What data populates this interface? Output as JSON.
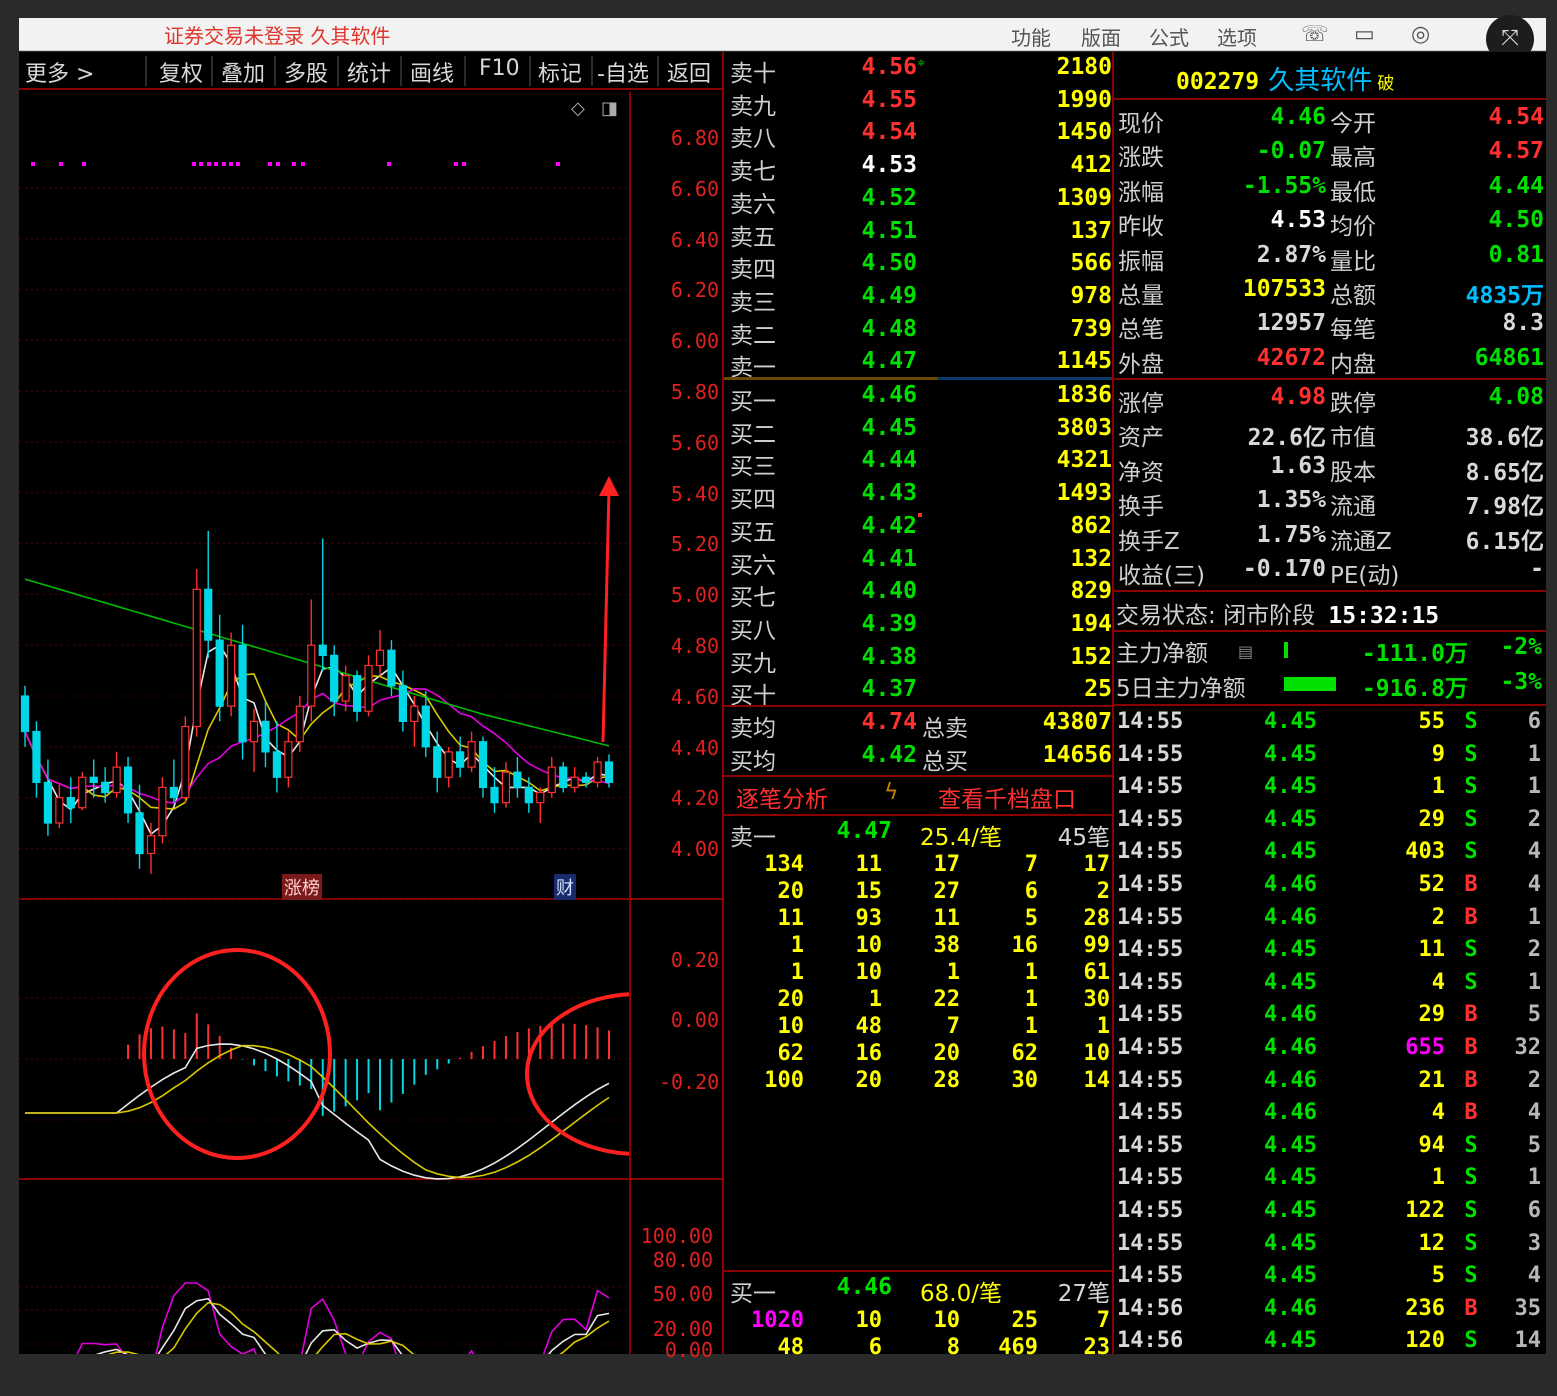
{
  "titlebar": {
    "title": "证券交易未登录 久其软件",
    "menus": [
      "功能",
      "版面",
      "公式",
      "选项"
    ]
  },
  "toolbar": {
    "items": [
      "更多 >",
      "复权",
      "叠加",
      "多股",
      "统计",
      "画线",
      "F10",
      "标记",
      "-自选",
      "返回"
    ]
  },
  "chart": {
    "price_labels": [
      "6.80",
      "6.60",
      "6.40",
      "6.20",
      "6.00",
      "5.80",
      "5.60",
      "5.40",
      "5.20",
      "5.00",
      "4.80",
      "4.60",
      "4.40",
      "4.20",
      "4.00"
    ],
    "macd_labels": [
      "0.20",
      "0.00",
      "-0.20"
    ],
    "kdj_labels": [
      "100.00",
      "80.00",
      "50.00",
      "20.00",
      "0.00"
    ],
    "badge_zhangbang": "涨榜",
    "badge_cai": "财"
  },
  "orderbook": {
    "asks": [
      {
        "label": "卖十",
        "price": "4.56",
        "vol": "2180",
        "color": "#ff3030"
      },
      {
        "label": "卖九",
        "price": "4.55",
        "vol": "1990",
        "color": "#ff3030"
      },
      {
        "label": "卖八",
        "price": "4.54",
        "vol": "1450",
        "color": "#ff3030"
      },
      {
        "label": "卖七",
        "price": "4.53",
        "vol": "412",
        "color": "#ffffff"
      },
      {
        "label": "卖六",
        "price": "4.52",
        "vol": "1309",
        "color": "#00e000"
      },
      {
        "label": "卖五",
        "price": "4.51",
        "vol": "137",
        "color": "#00e000"
      },
      {
        "label": "卖四",
        "price": "4.50",
        "vol": "566",
        "color": "#00e000"
      },
      {
        "label": "卖三",
        "price": "4.49",
        "vol": "978",
        "color": "#00e000"
      },
      {
        "label": "卖二",
        "price": "4.48",
        "vol": "739",
        "color": "#00e000"
      },
      {
        "label": "卖一",
        "price": "4.47",
        "vol": "1145",
        "color": "#00e000"
      }
    ],
    "bids": [
      {
        "label": "买一",
        "price": "4.46",
        "vol": "1836",
        "color": "#00e000"
      },
      {
        "label": "买二",
        "price": "4.45",
        "vol": "3803",
        "color": "#00e000"
      },
      {
        "label": "买三",
        "price": "4.44",
        "vol": "4321",
        "color": "#00e000"
      },
      {
        "label": "买四",
        "price": "4.43",
        "vol": "1493",
        "color": "#00e000"
      },
      {
        "label": "买五",
        "price": "4.42",
        "vol": "862",
        "color": "#00e000"
      },
      {
        "label": "买六",
        "price": "4.41",
        "vol": "132",
        "color": "#00e000"
      },
      {
        "label": "买七",
        "price": "4.40",
        "vol": "829",
        "color": "#00e000"
      },
      {
        "label": "买八",
        "price": "4.39",
        "vol": "194",
        "color": "#00e000"
      },
      {
        "label": "买九",
        "price": "4.38",
        "vol": "152",
        "color": "#00e000"
      },
      {
        "label": "买十",
        "price": "4.37",
        "vol": "25",
        "color": "#00e000"
      }
    ],
    "avg_sell": {
      "label": "卖均",
      "price": "4.74",
      "tlabel": "总卖",
      "total": "43807"
    },
    "avg_buy": {
      "label": "买均",
      "price": "4.42",
      "tlabel": "总买",
      "total": "14656"
    },
    "tabs": {
      "left": "逐笔分析",
      "right": "查看千档盘口"
    }
  },
  "ticks_sell1": {
    "label": "卖一",
    "price": "4.47",
    "per": "25.4/笔",
    "count": "45笔",
    "rows": [
      [
        "134",
        "11",
        "17",
        "7",
        "17"
      ],
      [
        "20",
        "15",
        "27",
        "6",
        "2"
      ],
      [
        "11",
        "93",
        "11",
        "5",
        "28"
      ],
      [
        "1",
        "10",
        "38",
        "16",
        "99"
      ],
      [
        "1",
        "10",
        "1",
        "1",
        "61"
      ],
      [
        "20",
        "1",
        "22",
        "1",
        "30"
      ],
      [
        "10",
        "48",
        "7",
        "1",
        "1"
      ],
      [
        "62",
        "16",
        "20",
        "62",
        "10"
      ],
      [
        "100",
        "20",
        "28",
        "30",
        "14"
      ]
    ]
  },
  "ticks_buy1": {
    "label": "买一",
    "price": "4.46",
    "per": "68.0/笔",
    "count": "27笔",
    "rows": [
      [
        "1020",
        "10",
        "10",
        "25",
        "7"
      ],
      [
        "48",
        "6",
        "8",
        "469",
        "23"
      ]
    ]
  },
  "quote": {
    "code": "002279",
    "name": "久其软件",
    "tag": "破",
    "rows": [
      {
        "l1": "现价",
        "v1": "4.46",
        "c1": "#00e000",
        "l2": "今开",
        "v2": "4.54",
        "c2": "#ff3030"
      },
      {
        "l1": "涨跌",
        "v1": "-0.07",
        "c1": "#00e000",
        "l2": "最高",
        "v2": "4.57",
        "c2": "#ff3030"
      },
      {
        "l1": "涨幅",
        "v1": "-1.55%",
        "c1": "#00e000",
        "l2": "最低",
        "v2": "4.44",
        "c2": "#00e000"
      },
      {
        "l1": "昨收",
        "v1": "4.53",
        "c1": "#ffffff",
        "l2": "均价",
        "v2": "4.50",
        "c2": "#00e000"
      },
      {
        "l1": "振幅",
        "v1": "2.87%",
        "c1": "#d8d8d8",
        "l2": "量比",
        "v2": "0.81",
        "c2": "#00e000"
      },
      {
        "l1": "总量",
        "v1": "107533",
        "c1": "#ffff00",
        "l2": "总额",
        "v2": "4835万",
        "c2": "#00bfff"
      },
      {
        "l1": "总笔",
        "v1": "12957",
        "c1": "#d8d8d8",
        "l2": "每笔",
        "v2": "8.3",
        "c2": "#d8d8d8"
      },
      {
        "l1": "外盘",
        "v1": "42672",
        "c1": "#ff3030",
        "l2": "内盘",
        "v2": "64861",
        "c2": "#00e000"
      }
    ],
    "rows2": [
      {
        "l1": "涨停",
        "v1": "4.98",
        "c1": "#ff3030",
        "l2": "跌停",
        "v2": "4.08",
        "c2": "#00e000"
      },
      {
        "l1": "资产",
        "v1": "22.6亿",
        "c1": "#d8d8d8",
        "l2": "市值",
        "v2": "38.6亿",
        "c2": "#d8d8d8"
      },
      {
        "l1": "净资",
        "v1": "1.63",
        "c1": "#d8d8d8",
        "l2": "股本",
        "v2": "8.65亿",
        "c2": "#d8d8d8"
      },
      {
        "l1": "换手",
        "v1": "1.35%",
        "c1": "#d8d8d8",
        "l2": "流通",
        "v2": "7.98亿",
        "c2": "#d8d8d8"
      },
      {
        "l1": "换手Z",
        "v1": "1.75%",
        "c1": "#d8d8d8",
        "l2": "流通Z",
        "v2": "6.15亿",
        "c2": "#d8d8d8"
      },
      {
        "l1": "收益(三)",
        "v1": "-0.170",
        "c1": "#d8d8d8",
        "l2": "PE(动)",
        "v2": "-",
        "c2": "#d8d8d8"
      }
    ],
    "status_label": "交易状态:",
    "status": "闭市阶段",
    "time": "15:32:15",
    "main_net": {
      "label": "主力净额",
      "value": "-111.0万",
      "pct": "-2%"
    },
    "main_net5": {
      "label": "5日主力净额",
      "value": "-916.8万",
      "pct": "-3%"
    }
  },
  "trades": [
    {
      "t": "14:55",
      "p": "4.45",
      "v": "55",
      "s": "S",
      "n": "6"
    },
    {
      "t": "14:55",
      "p": "4.45",
      "v": "9",
      "s": "S",
      "n": "1"
    },
    {
      "t": "14:55",
      "p": "4.45",
      "v": "1",
      "s": "S",
      "n": "1"
    },
    {
      "t": "14:55",
      "p": "4.45",
      "v": "29",
      "s": "S",
      "n": "2"
    },
    {
      "t": "14:55",
      "p": "4.45",
      "v": "403",
      "s": "S",
      "n": "4"
    },
    {
      "t": "14:55",
      "p": "4.46",
      "v": "52",
      "s": "B",
      "n": "4"
    },
    {
      "t": "14:55",
      "p": "4.46",
      "v": "2",
      "s": "B",
      "n": "1"
    },
    {
      "t": "14:55",
      "p": "4.45",
      "v": "11",
      "s": "S",
      "n": "2"
    },
    {
      "t": "14:55",
      "p": "4.45",
      "v": "4",
      "s": "S",
      "n": "1"
    },
    {
      "t": "14:55",
      "p": "4.46",
      "v": "29",
      "s": "B",
      "n": "5"
    },
    {
      "t": "14:55",
      "p": "4.46",
      "v": "655",
      "s": "B",
      "n": "32"
    },
    {
      "t": "14:55",
      "p": "4.46",
      "v": "21",
      "s": "B",
      "n": "2"
    },
    {
      "t": "14:55",
      "p": "4.46",
      "v": "4",
      "s": "B",
      "n": "4"
    },
    {
      "t": "14:55",
      "p": "4.45",
      "v": "94",
      "s": "S",
      "n": "5"
    },
    {
      "t": "14:55",
      "p": "4.45",
      "v": "1",
      "s": "S",
      "n": "1"
    },
    {
      "t": "14:55",
      "p": "4.45",
      "v": "122",
      "s": "S",
      "n": "6"
    },
    {
      "t": "14:55",
      "p": "4.45",
      "v": "12",
      "s": "S",
      "n": "3"
    },
    {
      "t": "14:55",
      "p": "4.45",
      "v": "5",
      "s": "S",
      "n": "4"
    },
    {
      "t": "14:56",
      "p": "4.46",
      "v": "236",
      "s": "B",
      "n": "35"
    },
    {
      "t": "14:56",
      "p": "4.45",
      "v": "120",
      "s": "S",
      "n": "14"
    }
  ],
  "colors": {
    "up": "#ff3030",
    "down": "#00e000",
    "grid": "#8b0000",
    "volume": "#ffff00"
  }
}
